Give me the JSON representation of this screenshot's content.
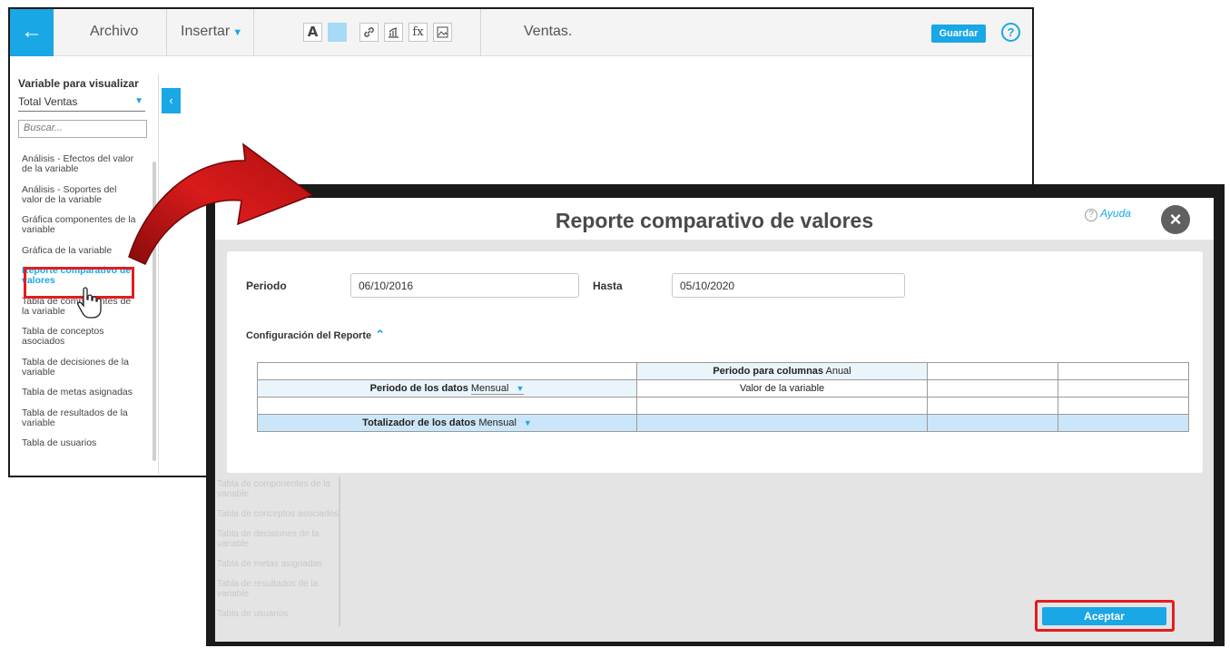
{
  "editor": {
    "menu": {
      "file": "Archivo",
      "insert": "Insertar"
    },
    "document_title": "Ventas.",
    "save_label": "Guardar",
    "help_label": "?",
    "toolbar": {
      "font": "A",
      "link": "🔗",
      "chart": "📊",
      "formula": "fx",
      "image": "🖼"
    },
    "sidebar": {
      "title": "Variable para visualizar",
      "selected_variable": "Total Ventas",
      "search_placeholder": "Buscar...",
      "items": [
        "Análisis - Efectos del valor de la variable",
        "Análisis - Soportes del valor de la variable",
        "Gráfica componentes de la variable",
        "Gráfica de la variable",
        "Reporte comparativo de valores",
        "Tabla de componentes de la variable",
        "Tabla de conceptos asociados",
        "Tabla de decisiones de la variable",
        "Tabla de metas asignadas",
        "Tabla de resultados de la variable",
        "Tabla de usuarios"
      ],
      "active_index": 4
    }
  },
  "modal": {
    "title": "Reporte comparativo de valores",
    "help": "Ayuda",
    "period_label": "Periodo",
    "period_from": "06/10/2016",
    "until_label": "Hasta",
    "period_to": "05/10/2020",
    "config_label": "Configuración del Reporte",
    "table": {
      "columns_period_label": "Periodo para columnas",
      "columns_period_value": "Anual",
      "data_period_label": "Periodo de los datos",
      "data_period_value": "Mensual",
      "value_label": "Valor de la variable",
      "totalizer_label": "Totalizador de los datos",
      "totalizer_value": "Mensual"
    },
    "ghost_items": [
      "Tabla de componentes de la variable",
      "Tabla de conceptos asociados",
      "Tabla de decisiones de la variable",
      "Tabla de metas asignadas",
      "Tabla de resultados de la variable",
      "Tabla de usuarios"
    ],
    "accept_label": "Aceptar"
  },
  "colors": {
    "accent": "#19a7e6",
    "highlight": "#e21d1d",
    "arrow": "#c41414"
  }
}
